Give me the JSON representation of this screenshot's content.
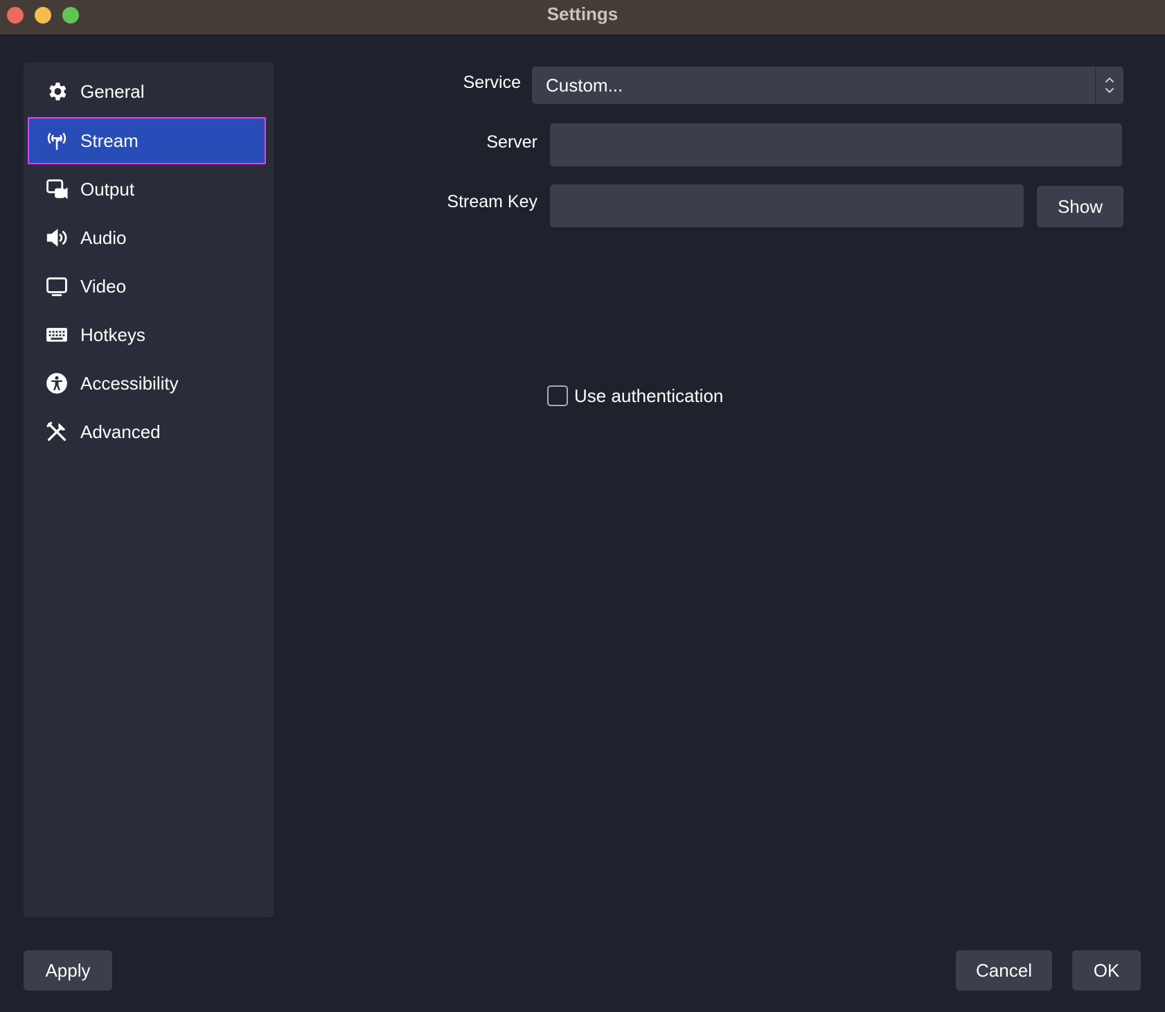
{
  "window": {
    "title": "Settings"
  },
  "sidebar": {
    "items": [
      {
        "label": "General",
        "icon": "gear-icon",
        "active": false
      },
      {
        "label": "Stream",
        "icon": "antenna-icon",
        "active": true
      },
      {
        "label": "Output",
        "icon": "output-icon",
        "active": false
      },
      {
        "label": "Audio",
        "icon": "speaker-icon",
        "active": false
      },
      {
        "label": "Video",
        "icon": "monitor-icon",
        "active": false
      },
      {
        "label": "Hotkeys",
        "icon": "keyboard-icon",
        "active": false
      },
      {
        "label": "Accessibility",
        "icon": "accessibility-icon",
        "active": false
      },
      {
        "label": "Advanced",
        "icon": "tools-icon",
        "active": false
      }
    ]
  },
  "form": {
    "service_label": "Service",
    "service_value": "Custom...",
    "server_label": "Server",
    "server_value": "",
    "stream_key_label": "Stream Key",
    "stream_key_value": "",
    "show_label": "Show",
    "use_auth_label": "Use authentication",
    "use_auth_checked": false
  },
  "footer": {
    "apply_label": "Apply",
    "cancel_label": "Cancel",
    "ok_label": "OK"
  },
  "colors": {
    "background": "#1f222c",
    "sidebar": "#2a2d39",
    "input": "#3b3f4c",
    "accent": "#284cb8",
    "focus_outline": "#d946ef",
    "titlebar": "#453c37"
  }
}
